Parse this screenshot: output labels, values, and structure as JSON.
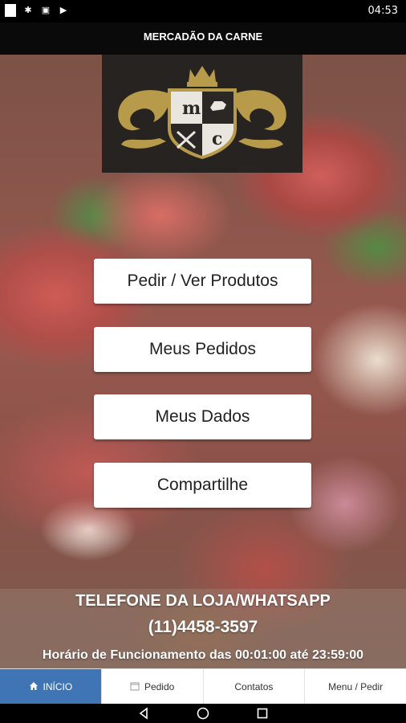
{
  "status_bar": {
    "time": "04:53",
    "icons": [
      "notification-box-icon",
      "bug-icon",
      "download-icon",
      "play-store-icon"
    ]
  },
  "header": {
    "title": "MERCADÃO DA CARNE"
  },
  "logo": {
    "letters": [
      "m",
      "c"
    ],
    "colors": {
      "gold": "#b79a4a",
      "dark": "#262320",
      "shield_dark": "#2a2724",
      "shield_light": "#e9e6e0"
    }
  },
  "menu": {
    "order_button": "Pedir / Ver Produtos",
    "my_orders_button": "Meus Pedidos",
    "my_data_button": "Meus Dados",
    "share_button": "Compartilhe"
  },
  "store_info": {
    "phone_label": "TELEFONE DA LOJA/WHATSAPP",
    "phone_number": "(11)4458-3597",
    "hours": "Horário de Funcionamento das 00:01:00 até 23:59:00"
  },
  "bottom_nav": {
    "home": {
      "label": "INÍCIO",
      "icon": "home-icon"
    },
    "order": {
      "label": "Pedido",
      "icon": "cart-icon"
    },
    "contacts": {
      "label": "Contatos"
    },
    "menu": {
      "label": "Menu / Pedir"
    }
  },
  "colors": {
    "accent": "#3f74b5",
    "header_bg": "#0a0a0a"
  },
  "system_nav": {
    "icons": [
      "back-icon",
      "home-circle-icon",
      "recents-icon"
    ]
  }
}
